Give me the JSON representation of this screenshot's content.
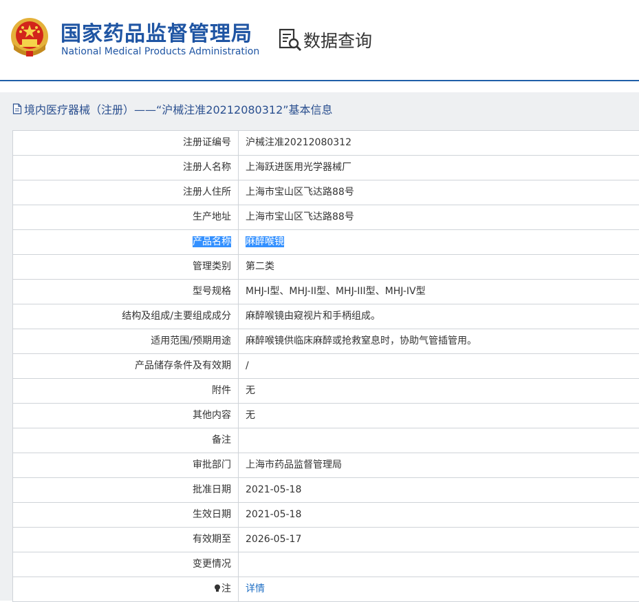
{
  "header": {
    "title_cn": "国家药品监督管理局",
    "title_en": "National Medical Products Administration",
    "query_label": "数据查询"
  },
  "panel": {
    "title": "境内医疗器械（注册）——“沪械注准20212080312”基本信息"
  },
  "rows": [
    {
      "label": "注册证编号",
      "value": "沪械注准20212080312"
    },
    {
      "label": "注册人名称",
      "value": "上海跃进医用光学器械厂"
    },
    {
      "label": "注册人住所",
      "value": "上海市宝山区飞达路88号"
    },
    {
      "label": "生产地址",
      "value": "上海市宝山区飞达路88号"
    },
    {
      "label": "产品名称",
      "value": "麻醉喉镜"
    },
    {
      "label": "管理类别",
      "value": "第二类"
    },
    {
      "label": "型号规格",
      "value": "MHJ-I型、MHJ-II型、MHJ-III型、MHJ-IV型"
    },
    {
      "label": "结构及组成/主要组成成分",
      "value": "麻醉喉镜由窥视片和手柄组成。"
    },
    {
      "label": "适用范围/预期用途",
      "value": "麻醉喉镜供临床麻醉或抢救窒息时，协助气管插管用。"
    },
    {
      "label": "产品储存条件及有效期",
      "value": "/"
    },
    {
      "label": "附件",
      "value": "无"
    },
    {
      "label": "其他内容",
      "value": "无"
    },
    {
      "label": "备注",
      "value": ""
    },
    {
      "label": "审批部门",
      "value": "上海市药品监督管理局"
    },
    {
      "label": "批准日期",
      "value": "2021-05-18"
    },
    {
      "label": "生效日期",
      "value": "2021-05-18"
    },
    {
      "label": "有效期至",
      "value": "2026-05-17"
    },
    {
      "label": "变更情况",
      "value": ""
    },
    {
      "label": "注",
      "value": "详情"
    }
  ],
  "colors": {
    "brand_blue": "#1f55a3",
    "selection": "#3390ff",
    "link": "#1f6fc4"
  },
  "icons": {
    "emblem": "national-emblem-icon",
    "query": "search-document-icon",
    "doc": "document-icon",
    "bulb": "lightbulb-icon"
  }
}
